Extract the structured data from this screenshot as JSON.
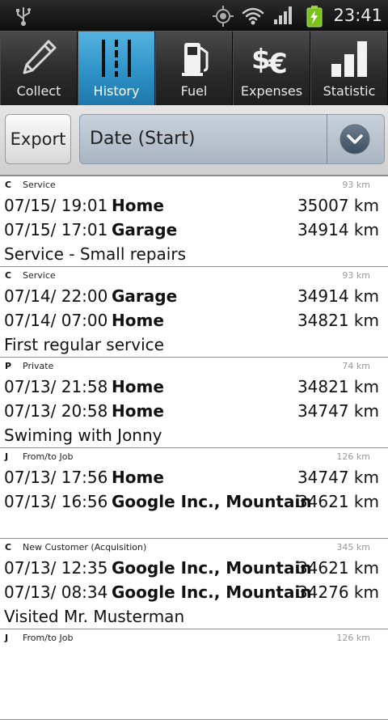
{
  "status_bar": {
    "time": "23:41",
    "icons": [
      "usb-icon",
      "gps-icon",
      "wifi-icon",
      "signal-icon",
      "battery-charging-icon"
    ]
  },
  "tabs": [
    {
      "label": "Collect",
      "icon": "pencil-icon",
      "active": false
    },
    {
      "label": "History",
      "icon": "road-icon",
      "active": true
    },
    {
      "label": "Fuel",
      "icon": "fuel-pump-icon",
      "active": false
    },
    {
      "label": "Expenses",
      "icon": "currency-icon",
      "active": false
    },
    {
      "label": "Statistic",
      "icon": "bar-chart-icon",
      "active": false
    }
  ],
  "toolbar": {
    "export_label": "Export",
    "sort_value": "Date (Start)"
  },
  "colors": {
    "active_tab": "#2b8fc4",
    "distance_text": "#999999"
  },
  "entries": [
    {
      "code": "C",
      "category": "Service",
      "distance": "93 km",
      "end_time": "07/15/ 19:01",
      "end_place": "Home",
      "end_odo": "35007 km",
      "start_time": "07/15/ 17:01",
      "start_place": "Garage",
      "start_odo": "34914 km",
      "note": "Service - Small repairs"
    },
    {
      "code": "C",
      "category": "Service",
      "distance": "93 km",
      "end_time": "07/14/ 22:00",
      "end_place": "Garage",
      "end_odo": "34914 km",
      "start_time": "07/14/ 07:00",
      "start_place": "Home",
      "start_odo": "34821 km",
      "note": "First regular service"
    },
    {
      "code": "P",
      "category": "Private",
      "distance": "74 km",
      "end_time": "07/13/ 21:58",
      "end_place": "Home",
      "end_odo": "34821 km",
      "start_time": "07/13/ 20:58",
      "start_place": "Home",
      "start_odo": "34747 km",
      "note": "Swiming with Jonny"
    },
    {
      "code": "J",
      "category": "From/to Job",
      "distance": "126 km",
      "end_time": "07/13/ 17:56",
      "end_place": "Home",
      "end_odo": "34747 km",
      "start_time": "07/13/ 16:56",
      "start_place": "Google Inc., Mountain",
      "start_odo": "34621 km",
      "note": ""
    },
    {
      "code": "C",
      "category": "New Customer (Acquisition)",
      "distance": "345 km",
      "end_time": "07/13/ 12:35",
      "end_place": "Google Inc., Mountain",
      "end_odo": "34621 km",
      "start_time": "07/13/ 08:34",
      "start_place": "Google Inc., Mountain",
      "start_odo": "34276 km",
      "note": "Visited Mr. Musterman"
    },
    {
      "code": "J",
      "category": "From/to Job",
      "distance": "126 km",
      "end_time": "",
      "end_place": "",
      "end_odo": "",
      "start_time": "",
      "start_place": "",
      "start_odo": "",
      "note": ""
    }
  ]
}
